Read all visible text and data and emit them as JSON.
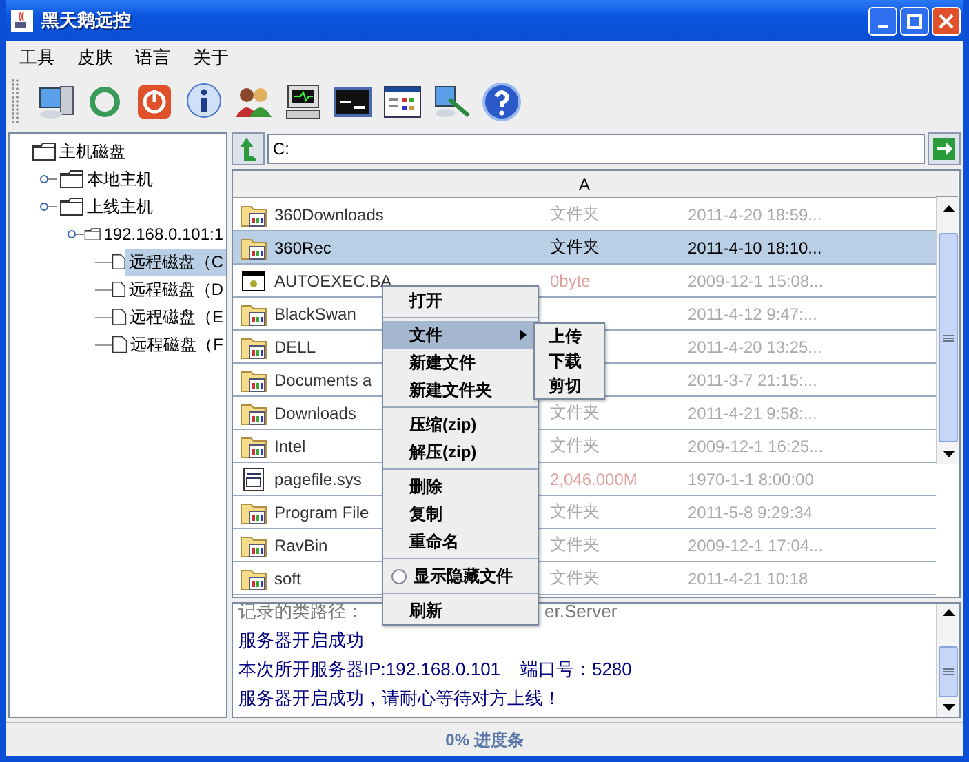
{
  "window": {
    "title": "黑天鹅远控"
  },
  "menu_bar": [
    "工具",
    "皮肤",
    "语言",
    "关于"
  ],
  "tree": {
    "label": "主机磁盘",
    "selected": false,
    "children": [
      {
        "label": "本地主机",
        "selected": false
      },
      {
        "label": "上线主机",
        "selected": false,
        "children": [
          {
            "label": "192.168.0.101:1",
            "selected": false,
            "children": [
              {
                "label": "远程磁盘（C",
                "selected": true,
                "kind": "file"
              },
              {
                "label": "远程磁盘（D",
                "selected": false,
                "kind": "file"
              },
              {
                "label": "远程磁盘（E",
                "selected": false,
                "kind": "file"
              },
              {
                "label": "远程磁盘（F",
                "selected": false,
                "kind": "file"
              }
            ]
          }
        ]
      }
    ]
  },
  "path_bar": {
    "value": "C:"
  },
  "table": {
    "columns": [
      "A"
    ],
    "rows": [
      {
        "kind": "folder",
        "name": "360Downloads",
        "info": "文件夹",
        "date": "2011-4-20 18:59...",
        "selected": false
      },
      {
        "kind": "folder",
        "name": "360Rec",
        "info": "文件夹",
        "date": "2011-4-10 18:10...",
        "selected": true
      },
      {
        "kind": "program",
        "name": "AUTOEXEC.BA",
        "info": "0byte",
        "date": "2009-12-1 15:08...",
        "selected": false
      },
      {
        "kind": "folder",
        "name": "BlackSwan",
        "info": "",
        "date": "2011-4-12 9:47:...",
        "selected": false
      },
      {
        "kind": "folder",
        "name": "DELL",
        "info": "",
        "date": "2011-4-20 13:25...",
        "selected": false
      },
      {
        "kind": "folder",
        "name": "Documents a",
        "info": "",
        "date": "2011-3-7 21:15:...",
        "selected": false
      },
      {
        "kind": "folder",
        "name": "Downloads",
        "info": "文件夹",
        "date": "2011-4-21 9:58:...",
        "selected": false
      },
      {
        "kind": "folder",
        "name": "Intel",
        "info": "文件夹",
        "date": "2009-12-1 16:25...",
        "selected": false
      },
      {
        "kind": "system",
        "name": "pagefile.sys",
        "info": "2,046.000M",
        "date": "1970-1-1 8:00:00",
        "selected": false
      },
      {
        "kind": "folder",
        "name": "Program File",
        "info": "文件夹",
        "date": "2011-5-8 9:29:34",
        "selected": false
      },
      {
        "kind": "folder",
        "name": "RavBin",
        "info": "文件夹",
        "date": "2009-12-1 17:04...",
        "selected": false
      },
      {
        "kind": "folder",
        "name": "soft",
        "info": "文件夹",
        "date": "2011-4-21 10:18",
        "selected": false
      }
    ]
  },
  "log": {
    "lines": [
      {
        "kind": "muted",
        "segments": [
          "记录的类路径：",
          "er.Server"
        ]
      },
      {
        "kind": "normal",
        "segments": [
          "服务器开启成功"
        ]
      },
      {
        "kind": "normal",
        "segments": [
          "本次所开服务器IP:192.168.0.101    端口号：5280"
        ]
      },
      {
        "kind": "normal",
        "segments": [
          "服务器开启成功，请耐心等待对方上线！"
        ]
      }
    ]
  },
  "context_menu": {
    "groups": [
      [
        {
          "kind": "item",
          "label": "打开",
          "selected": false
        }
      ],
      [
        {
          "kind": "submenu",
          "label": "文件",
          "selected": true
        },
        {
          "kind": "item",
          "label": "新建文件",
          "selected": false
        },
        {
          "kind": "item",
          "label": "新建文件夹",
          "selected": false
        }
      ],
      [
        {
          "kind": "item",
          "label": "压缩(zip)",
          "selected": false
        },
        {
          "kind": "item",
          "label": "解压(zip)",
          "selected": false
        }
      ],
      [
        {
          "kind": "item",
          "label": "删除",
          "selected": false
        },
        {
          "kind": "item",
          "label": "复制",
          "selected": false
        },
        {
          "kind": "item",
          "label": "重命名",
          "selected": false
        }
      ],
      [
        {
          "kind": "radio",
          "label": "显示隐藏文件",
          "selected": false,
          "checked": false
        }
      ],
      [
        {
          "kind": "item",
          "label": "刷新",
          "selected": false
        }
      ]
    ],
    "submenu": [
      "上传",
      "下载",
      "剪切"
    ]
  },
  "status_bar": {
    "label": "0% 进度条",
    "level": 0
  }
}
